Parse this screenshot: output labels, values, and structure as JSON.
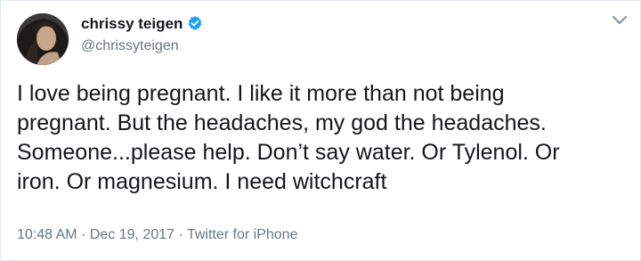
{
  "tweet": {
    "display_name": "chrissy teigen",
    "handle": "@chrissyteigen",
    "verified": true,
    "text": "I love being pregnant. I like it more than not being\npregnant. But the headaches, my god the headaches.\nSomeone...please help. Don’t say water. Or Tylenol. Or\niron. Or magnesium. I need witchcraft",
    "time": "10:48 AM",
    "date": "Dec 19, 2017",
    "source": "Twitter for iPhone",
    "separator": "·"
  },
  "icons": {
    "verified": "verified-badge-icon",
    "menu": "chevron-down-icon",
    "avatar": "profile-photo"
  },
  "colors": {
    "text": "#14171a",
    "secondary": "#657786",
    "verified": "#1da1f2",
    "border": "#e1e8ed"
  }
}
